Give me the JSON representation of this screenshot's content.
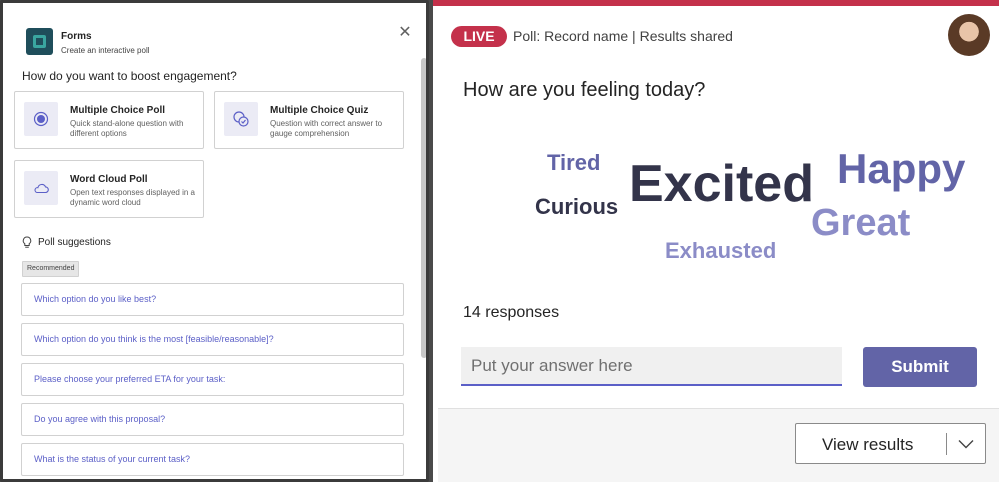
{
  "forms_panel": {
    "app_title": "Forms",
    "app_subtitle": "Create an interactive poll",
    "question_heading": "How do you want to boost engagement?",
    "options": [
      {
        "title": "Multiple Choice Poll",
        "description": "Quick stand-alone question with different options",
        "icon": "radio-circle-icon"
      },
      {
        "title": "Multiple Choice Quiz",
        "description": "Question with correct answer to gauge comprehension",
        "icon": "quiz-check-icon"
      },
      {
        "title": "Word Cloud Poll",
        "description": "Open text responses displayed in a dynamic word cloud",
        "icon": "cloud-icon"
      }
    ],
    "suggestions_heading": "Poll suggestions",
    "recommended_badge": "Recommended",
    "suggestions": [
      "Which option do you like best?",
      "Which option do you think is the most [feasible/reasonable]?",
      "Please choose your preferred ETA for your task:",
      "Do you agree with this proposal?",
      "What is the status of your current task?"
    ]
  },
  "poll_panel": {
    "live_badge": "LIVE",
    "status_line": "Poll: Record name | Results shared",
    "question": "How are you feeling today?",
    "word_cloud": [
      {
        "word": "Tired",
        "color": "#6264a7"
      },
      {
        "word": "Excited",
        "color": "#33344a"
      },
      {
        "word": "Happy",
        "color": "#6264a7"
      },
      {
        "word": "Curious",
        "color": "#33344a"
      },
      {
        "word": "Great",
        "color": "#8b8cc7"
      },
      {
        "word": "Exhausted",
        "color": "#8b8cc7"
      }
    ],
    "responses_text": "14 responses",
    "answer_placeholder": "Put your answer here",
    "submit_label": "Submit",
    "view_results_label": "View results"
  },
  "colors": {
    "live_red": "#c4314b",
    "accent": "#6264a7"
  }
}
